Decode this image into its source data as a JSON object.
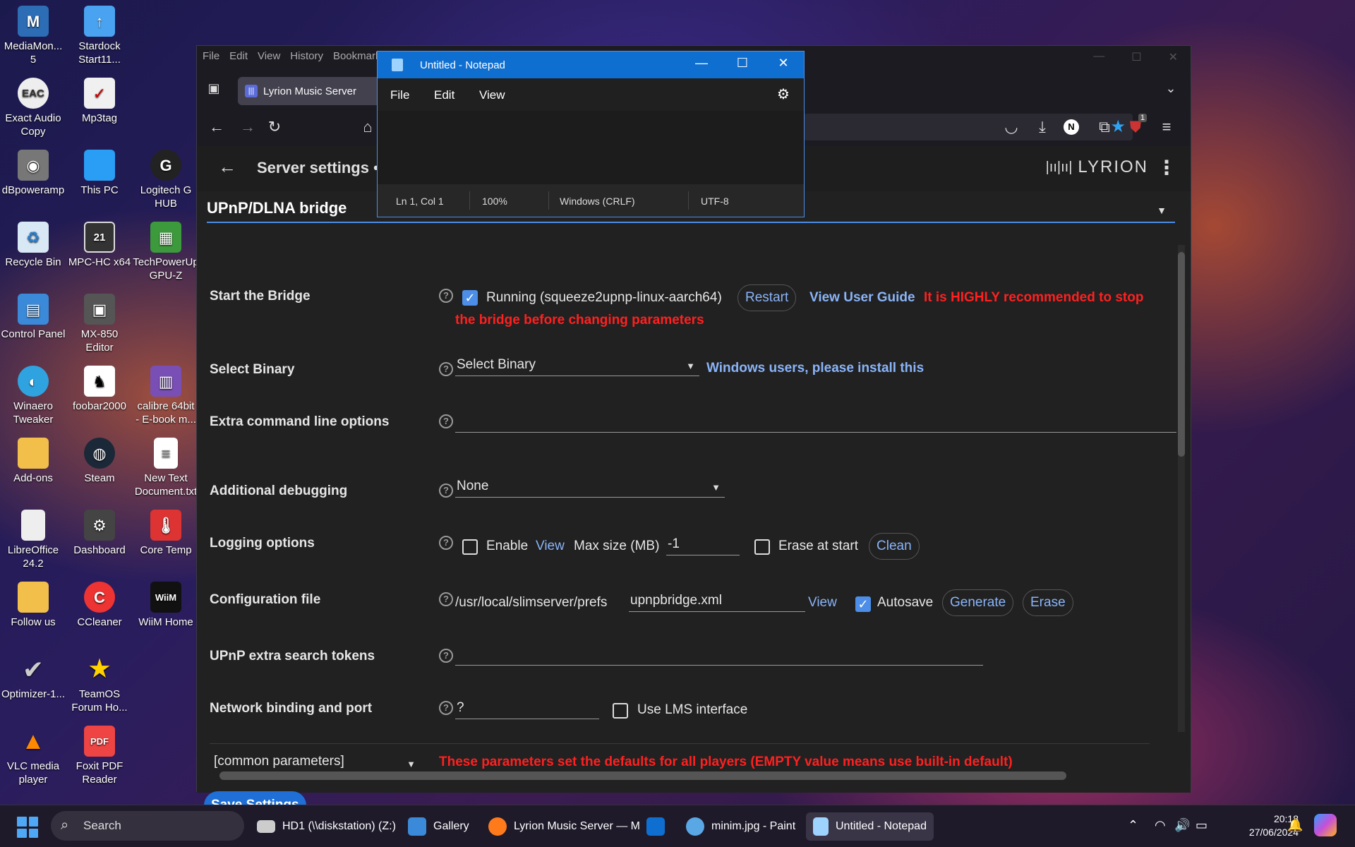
{
  "desktop": {
    "icons": [
      {
        "label": "MediaMon...\n5"
      },
      {
        "label": "Stardock\nStart11..."
      },
      {
        "label": "Exact Audio\nCopy"
      },
      {
        "label": "Mp3tag"
      },
      {
        "label": "dBpoweramp"
      },
      {
        "label": "This PC"
      },
      {
        "label": "Logitech G\nHUB"
      },
      {
        "label": "Recycle Bin"
      },
      {
        "label": "MPC-HC x64"
      },
      {
        "label": "TechPowerUp\nGPU-Z"
      },
      {
        "label": "Control Panel"
      },
      {
        "label": "MX-850\nEditor"
      },
      {
        "label": "Winaero\nTweaker"
      },
      {
        "label": "foobar2000"
      },
      {
        "label": "calibre 64bit\n- E-book m..."
      },
      {
        "label": "Add-ons"
      },
      {
        "label": "Steam"
      },
      {
        "label": "New Text\nDocument.txt"
      },
      {
        "label": "LibreOffice\n24.2"
      },
      {
        "label": "Dashboard"
      },
      {
        "label": "Core Temp"
      },
      {
        "label": "Follow us"
      },
      {
        "label": "CCleaner"
      },
      {
        "label": "WiiM Home"
      },
      {
        "label": "Optimizer-1..."
      },
      {
        "label": "TeamOS\nForum Ho..."
      },
      {
        "label": "VLC media\nplayer"
      },
      {
        "label": "Foxit PDF\nReader"
      }
    ]
  },
  "browser": {
    "menu": [
      "File",
      "Edit",
      "View",
      "History",
      "Bookmarks"
    ],
    "tab_label": "Lyrion Music Server",
    "tab_favicon": "|||",
    "extension_badge": "1",
    "profile_letter": "N",
    "app": {
      "title": "Server settings •",
      "brand": "LYRION",
      "section": "UPnP/DLNA bridge",
      "rows": {
        "start_bridge": {
          "label": "Start the Bridge",
          "status": "Running (squeeze2upnp-linux-aarch64)",
          "restart": "Restart",
          "guide": "View User Guide",
          "warning_1": "It is HIGHLY recommended to stop",
          "warning_2": "the bridge before changing parameters"
        },
        "select_binary": {
          "label": "Select Binary",
          "value": "Select Binary",
          "note": "Windows users, please install this"
        },
        "extra_cmd": {
          "label": "Extra command line options",
          "value": ""
        },
        "debugging": {
          "label": "Additional debugging",
          "value": "None"
        },
        "logging": {
          "label": "Logging options",
          "enable": "Enable",
          "view": "View",
          "max_size_label": "Max size (MB)",
          "max_size": "-1",
          "erase_start": "Erase at start",
          "clean": "Clean"
        },
        "config_file": {
          "label": "Configuration file",
          "path": "/usr/local/slimserver/prefs",
          "file": "upnpbridge.xml",
          "view": "View",
          "autosave": "Autosave",
          "generate": "Generate",
          "erase": "Erase"
        },
        "search_tokens": {
          "label": "UPnP extra search tokens",
          "value": ""
        },
        "network": {
          "label": "Network binding and port",
          "value": "?",
          "use_lms": "Use LMS interface"
        },
        "common": {
          "label": "[common parameters]",
          "note": "These parameters set the defaults for all players (EMPTY value means use built-in default)"
        }
      },
      "save_button": "Save Settings"
    }
  },
  "notepad": {
    "title": "Untitled - Notepad",
    "menu": [
      "File",
      "Edit",
      "View"
    ],
    "status": {
      "pos": "Ln 1, Col 1",
      "zoom": "100%",
      "eol": "Windows (CRLF)",
      "encoding": "UTF-8"
    }
  },
  "taskbar": {
    "search": "Search",
    "apps": [
      {
        "label": "HD1 (\\\\diskstation) (Z:)"
      },
      {
        "label": "Gallery"
      },
      {
        "label": "Lyrion Music Server — M"
      },
      {
        "label": ""
      },
      {
        "label": "minim.jpg - Paint"
      },
      {
        "label": "Untitled - Notepad"
      }
    ],
    "time": "20:18",
    "date": "27/06/2024"
  }
}
